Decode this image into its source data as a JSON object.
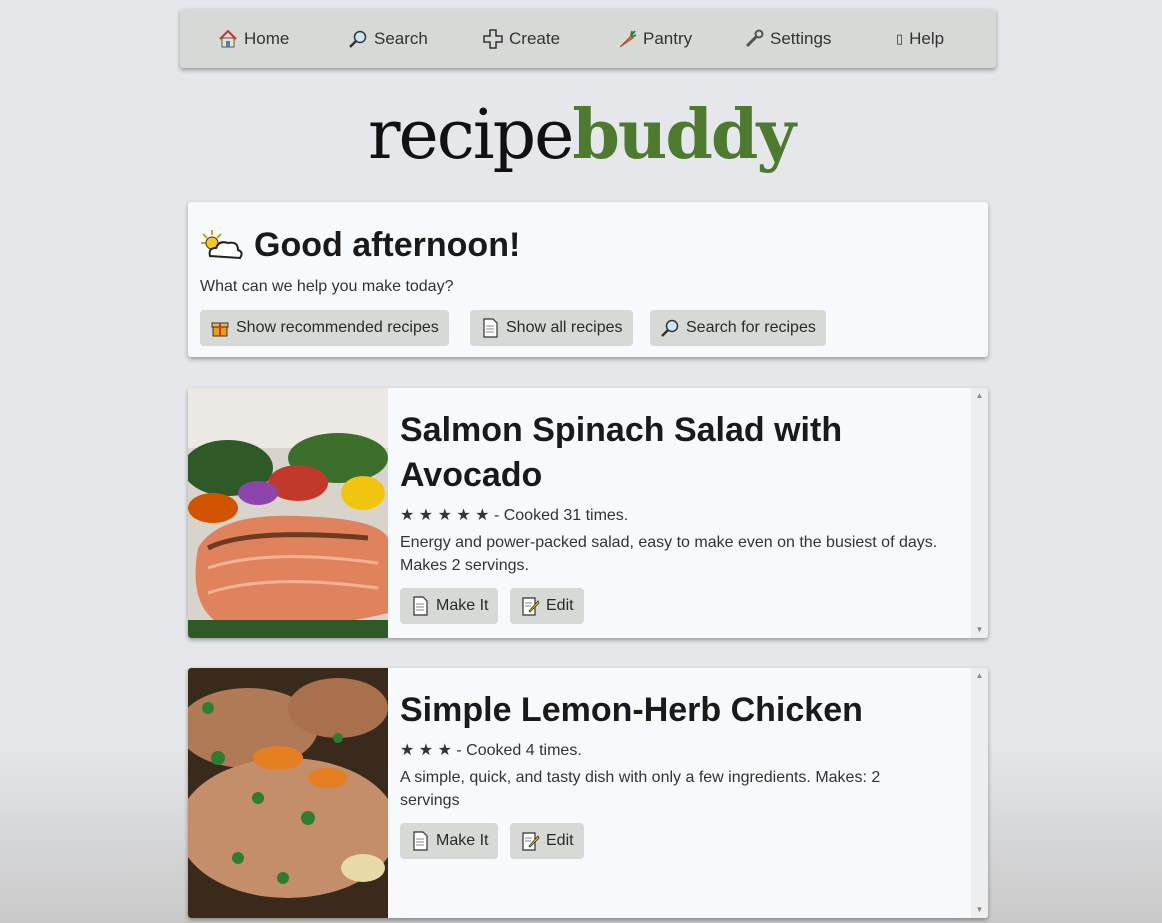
{
  "nav": {
    "items": [
      {
        "label": "Home",
        "icon": "house-icon"
      },
      {
        "label": "Search",
        "icon": "magnifier-icon"
      },
      {
        "label": "Create",
        "icon": "plus-icon"
      },
      {
        "label": "Pantry",
        "icon": "carrot-icon"
      },
      {
        "label": "Settings",
        "icon": "wrench-icon"
      },
      {
        "label": "Help",
        "icon": "unknown-glyph-icon"
      }
    ],
    "help_glyph": "▯"
  },
  "logo": {
    "part1": "recipe",
    "part2": "buddy"
  },
  "greeting": {
    "title": "Good afternoon!",
    "subtitle": "What can we help you make today?",
    "buttons": [
      {
        "label": "Show recommended recipes",
        "icon": "gift-icon"
      },
      {
        "label": "Show all recipes",
        "icon": "page-icon"
      },
      {
        "label": "Search for recipes",
        "icon": "magnifier-icon"
      }
    ]
  },
  "recipes": [
    {
      "title": "Salmon Spinach Salad with Avocado",
      "stars": "★ ★ ★ ★ ★",
      "rating": 5,
      "cooked": "- Cooked 31 times.",
      "description": "Energy and power-packed salad, easy to make even on the busiest of days. Makes 2 servings.",
      "make_label": "Make It",
      "edit_label": "Edit"
    },
    {
      "title": "Simple Lemon-Herb Chicken",
      "stars": "★ ★ ★",
      "rating": 3,
      "cooked": "- Cooked 4 times.",
      "description": "A simple, quick, and tasty dish with only a few ingredients. Makes: 2 servings",
      "make_label": "Make It",
      "edit_label": "Edit"
    }
  ],
  "colors": {
    "brand_green": "#4d7a2f",
    "button_bg": "#d6d9d6",
    "card_bg": "#f7fafd"
  }
}
